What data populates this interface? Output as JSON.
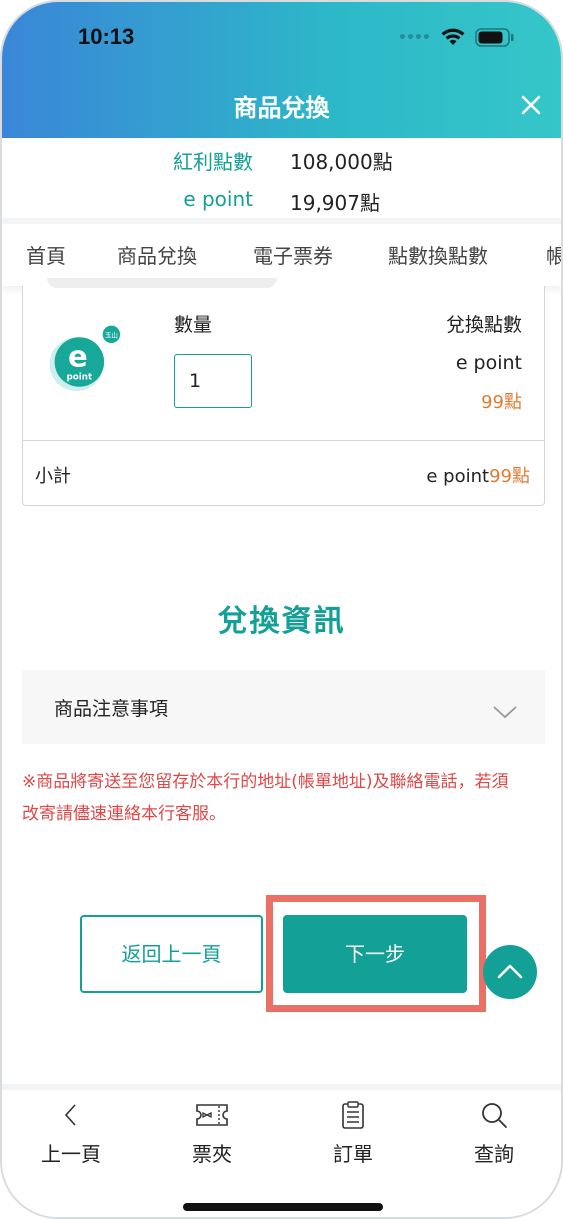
{
  "status_bar": {
    "time": "10:13"
  },
  "header": {
    "title": "商品兌換"
  },
  "points": [
    {
      "label": "紅利點數",
      "value": "108,000點"
    },
    {
      "label": "e point",
      "value": "19,907點"
    }
  ],
  "nav_tabs": [
    "首頁",
    "商品兌換",
    "電子票券",
    "點數換點數",
    "帳"
  ],
  "product": {
    "logo_text": "point",
    "logo_letter": "e",
    "logo_badge": "玉山",
    "quantity_label": "數量",
    "quantity_value": "1",
    "redeem_label": "兌換點數",
    "redeem_type": "e point",
    "redeem_points": "99點",
    "subtotal_label": "小計",
    "subtotal_type": "e point",
    "subtotal_points": "99點"
  },
  "redeem_info": {
    "title": "兌換資訊",
    "accordion_label": "商品注意事項",
    "notice": "※商品將寄送至您留存於本行的地址(帳單地址)及聯絡電話，若須改寄請儘速連絡本行客服。"
  },
  "buttons": {
    "back": "返回上一頁",
    "next": "下一步"
  },
  "tabbar": [
    {
      "label": "上一頁",
      "icon": "chevron-left-icon"
    },
    {
      "label": "票夾",
      "icon": "ticket-icon"
    },
    {
      "label": "訂單",
      "icon": "clipboard-icon"
    },
    {
      "label": "查詢",
      "icon": "search-icon"
    }
  ],
  "colors": {
    "accent": "#13a096",
    "points": "#e07b34",
    "notice": "#e04848",
    "highlight": "#ea6f64"
  }
}
